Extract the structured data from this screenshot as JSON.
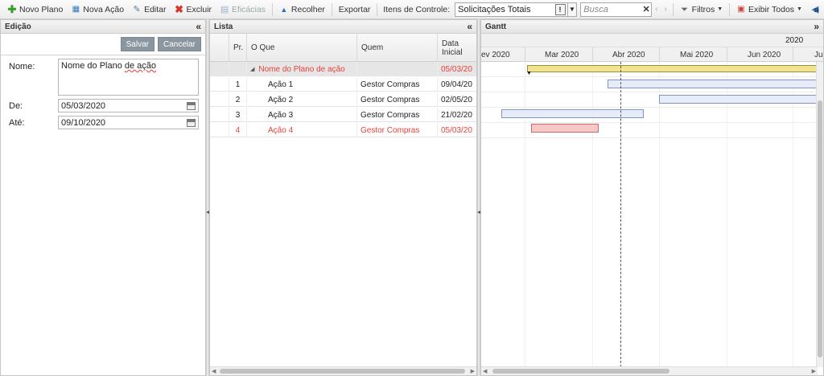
{
  "toolbar": {
    "novo_plano": "Novo Plano",
    "nova_acao": "Nova Ação",
    "editar": "Editar",
    "excluir": "Excluir",
    "eficacias": "Eficácias",
    "recolher": "Recolher",
    "exportar": "Exportar",
    "itens_label": "Itens de Controle:",
    "itens_value": "Solicitações Totais",
    "search_placeholder": "Busca",
    "filtros": "Filtros",
    "exibir_todos": "Exibir Todos"
  },
  "edit_panel": {
    "title": "Edição",
    "save": "Salvar",
    "cancel": "Cancelar",
    "nome_label": "Nome:",
    "nome_value_1": "Nome do Plano ",
    "nome_value_2": "de ação",
    "de_label": "De:",
    "de_value": "05/03/2020",
    "ate_label": "Até:",
    "ate_value": "09/10/2020"
  },
  "list_panel": {
    "title": "Lista",
    "columns": {
      "pr": "Pr.",
      "oque": "O Que",
      "quem": "Quem",
      "data": "Data Inicial"
    },
    "parent": {
      "pr": "",
      "oque": "Nome do Plano de ação",
      "quem": "",
      "data": "05/03/20"
    },
    "rows": [
      {
        "pr": "1",
        "oque": "Ação 1",
        "quem": "Gestor Compras",
        "data": "09/04/20"
      },
      {
        "pr": "2",
        "oque": "Ação 2",
        "quem": "Gestor Compras",
        "data": "02/05/20"
      },
      {
        "pr": "3",
        "oque": "Ação 3",
        "quem": "Gestor Compras",
        "data": "21/02/20"
      },
      {
        "pr": "4",
        "oque": "Ação 4",
        "quem": "Gestor Compras",
        "data": "05/03/20"
      }
    ]
  },
  "gantt_panel": {
    "title": "Gantt",
    "year": "2020",
    "months": [
      "ev 2020",
      "Mar 2020",
      "Abr 2020",
      "Mai 2020",
      "Jun 2020",
      "Ju"
    ]
  },
  "colors": {
    "parent_bar": "#f1e48f",
    "task_bar": "#e6edf9",
    "overdue_bar": "#f8c8c6",
    "overdue_text": "#e8403a"
  }
}
